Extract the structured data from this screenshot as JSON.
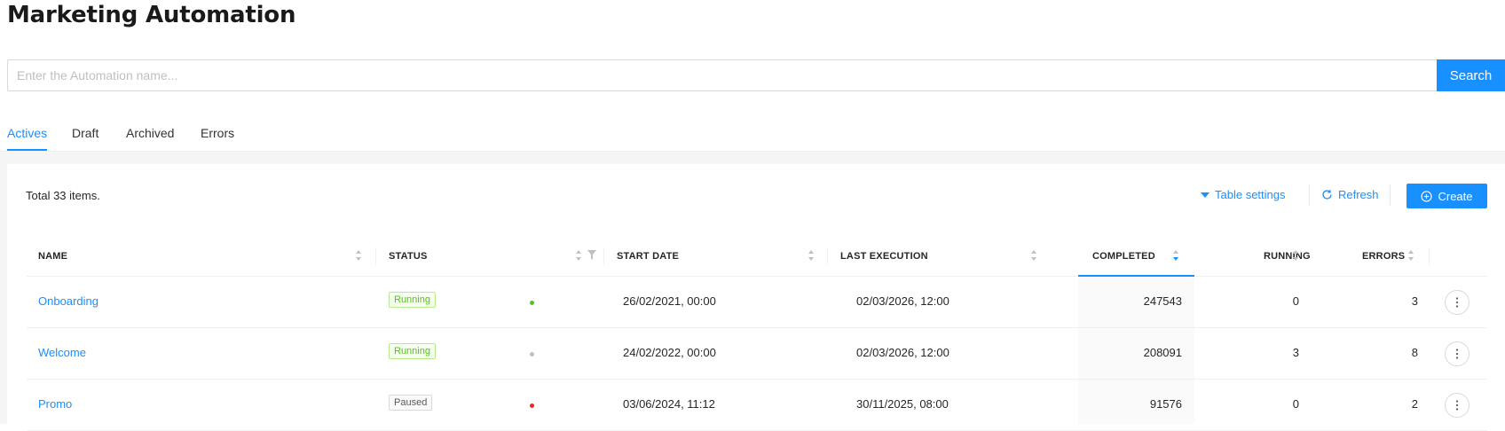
{
  "page": {
    "title": "Marketing Automation"
  },
  "search": {
    "placeholder": "Enter the Automation name...",
    "value": "",
    "button_label": "Search"
  },
  "tabs": [
    {
      "label": "Actives",
      "active": true
    },
    {
      "label": "Draft",
      "active": false
    },
    {
      "label": "Archived",
      "active": false
    },
    {
      "label": "Errors",
      "active": false
    }
  ],
  "toolbar": {
    "total_text": "Total 33 items.",
    "table_settings_label": "Table settings",
    "refresh_label": "Refresh",
    "create_label": "Create"
  },
  "table": {
    "columns": [
      "NAME",
      "STATUS",
      "START DATE",
      "LAST EXECUTION",
      "COMPLETED",
      "RUNNING",
      "ERRORS"
    ],
    "sorted_column": "COMPLETED",
    "sort_direction": "descending",
    "rows": [
      {
        "name": "Onboarding",
        "status": "Running",
        "status_color": "green",
        "indicator": "#52c41a",
        "start_date": "26/02/2021, 00:00",
        "last_execution": "02/03/2026, 12:00",
        "completed": "247543",
        "running": "0",
        "errors": "3"
      },
      {
        "name": "Welcome",
        "status": "Running",
        "status_color": "green",
        "indicator": "#bfbfbf",
        "start_date": "24/02/2022, 00:00",
        "last_execution": "02/03/2026, 12:00",
        "completed": "208091",
        "running": "3",
        "errors": "8"
      },
      {
        "name": "Promo",
        "status": "Paused",
        "status_color": "gray",
        "indicator": "#f5222d",
        "start_date": "03/06/2024, 11:12",
        "last_execution": "30/11/2025, 08:00",
        "completed": "91576",
        "running": "0",
        "errors": "2"
      }
    ]
  },
  "colors": {
    "accent": "#1890ff",
    "running_tag": "#52c41a",
    "paused_tag": "#595959"
  },
  "icons": {
    "table_settings": "caret-down-icon",
    "refresh": "reload-icon",
    "create": "plus-circle-icon",
    "sorter": "sort-icon",
    "filter": "filter-icon",
    "row_actions": "more-vertical-icon"
  }
}
